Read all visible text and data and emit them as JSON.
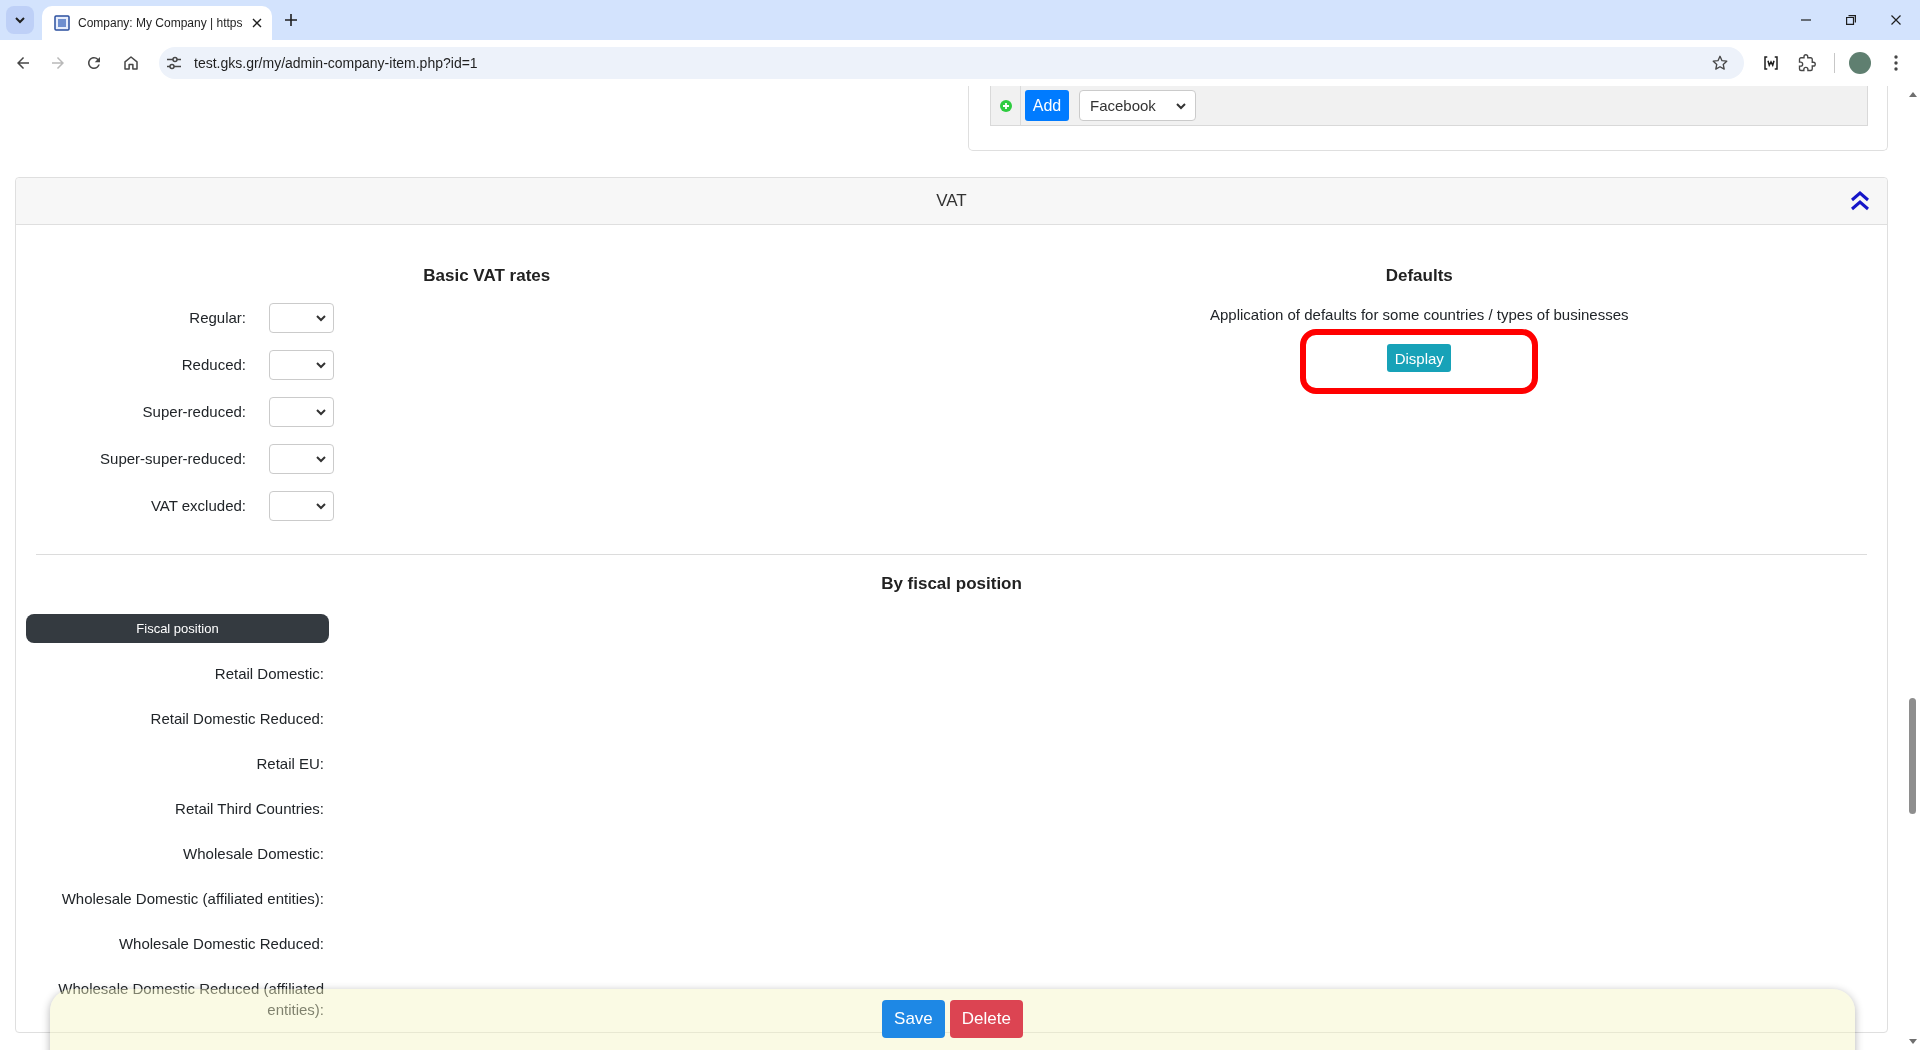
{
  "browser": {
    "tab": {
      "title": "Company: My Company | https",
      "selected": true
    },
    "forward_button": {
      "disabled": true
    },
    "address": "test.gks.gr/my/admin-company-item.php?id=1"
  },
  "social_links": {
    "add_button": "Add",
    "network_select": "Facebook"
  },
  "vat_section": {
    "title": "VAT",
    "expanded": true,
    "basic_rates": {
      "heading": "Basic VAT rates",
      "rows": [
        {
          "label": "Regular:"
        },
        {
          "label": "Reduced:"
        },
        {
          "label": "Super-reduced:"
        },
        {
          "label": "Super-super-reduced:"
        },
        {
          "label": "VAT excluded:"
        }
      ]
    },
    "defaults": {
      "heading": "Defaults",
      "description": "Application of defaults for some countries / types of businesses",
      "button": "Display",
      "highlighted": true
    },
    "fiscal": {
      "heading": "By fiscal position",
      "column_header": "Fiscal position",
      "rows": [
        {
          "label": "Retail Domestic:"
        },
        {
          "label": "Retail Domestic Reduced:"
        },
        {
          "label": "Retail EU:"
        },
        {
          "label": "Retail Third Countries:"
        },
        {
          "label": "Wholesale Domestic:"
        },
        {
          "label": "Wholesale Domestic (affiliated entities):"
        },
        {
          "label": "Wholesale Domestic Reduced:"
        },
        {
          "label": "Wholesale Domestic Reduced (affiliated entities):"
        }
      ]
    }
  },
  "actions": [
    {
      "label": "Save",
      "kind": "primary"
    },
    {
      "label": "Delete",
      "kind": "danger"
    }
  ]
}
